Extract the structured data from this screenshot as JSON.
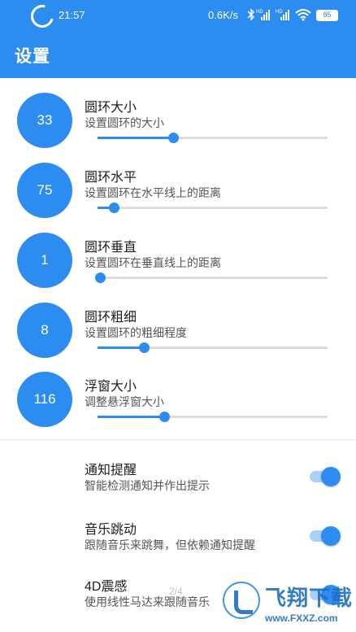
{
  "status_bar": {
    "time": "21:57",
    "net_speed": "0.6K/s",
    "battery": "85",
    "icons": [
      "bluetooth-icon",
      "signal-hd-icon",
      "signal-hd-icon",
      "wifi-icon",
      "battery-icon"
    ]
  },
  "app_bar": {
    "title": "设置"
  },
  "sliders": [
    {
      "value": "33",
      "title": "圆环大小",
      "subtitle": "设置圆环的大小",
      "level": 0.33
    },
    {
      "value": "75",
      "title": "圆环水平",
      "subtitle": "设置圆环在水平线上的距离",
      "level": 0.07
    },
    {
      "value": "1",
      "title": "圆环垂直",
      "subtitle": "设置圆环在垂直线上的距离",
      "level": 0.01
    },
    {
      "value": "8",
      "title": "圆环粗细",
      "subtitle": "设置圆环的粗细程度",
      "level": 0.2
    },
    {
      "value": "116",
      "title": "浮窗大小",
      "subtitle": "调整悬浮窗大小",
      "level": 0.29
    }
  ],
  "toggles": [
    {
      "title": "通知提醒",
      "subtitle": "智能检测通知并作出提示",
      "on": true
    },
    {
      "title": "音乐跳动",
      "subtitle": "跟随音乐来跳舞，但依赖通知提醒",
      "on": true
    },
    {
      "title": "4D震感",
      "subtitle": "使用线性马达来跟随音乐",
      "on": true
    }
  ],
  "page_indicator": "2/4",
  "watermark": {
    "text": "飞翔下载",
    "url": "www.FXXZ.com"
  },
  "colors": {
    "accent": "#2d8cf0",
    "track": "#dcdcdc",
    "switch_track": "#a9d0f9"
  }
}
